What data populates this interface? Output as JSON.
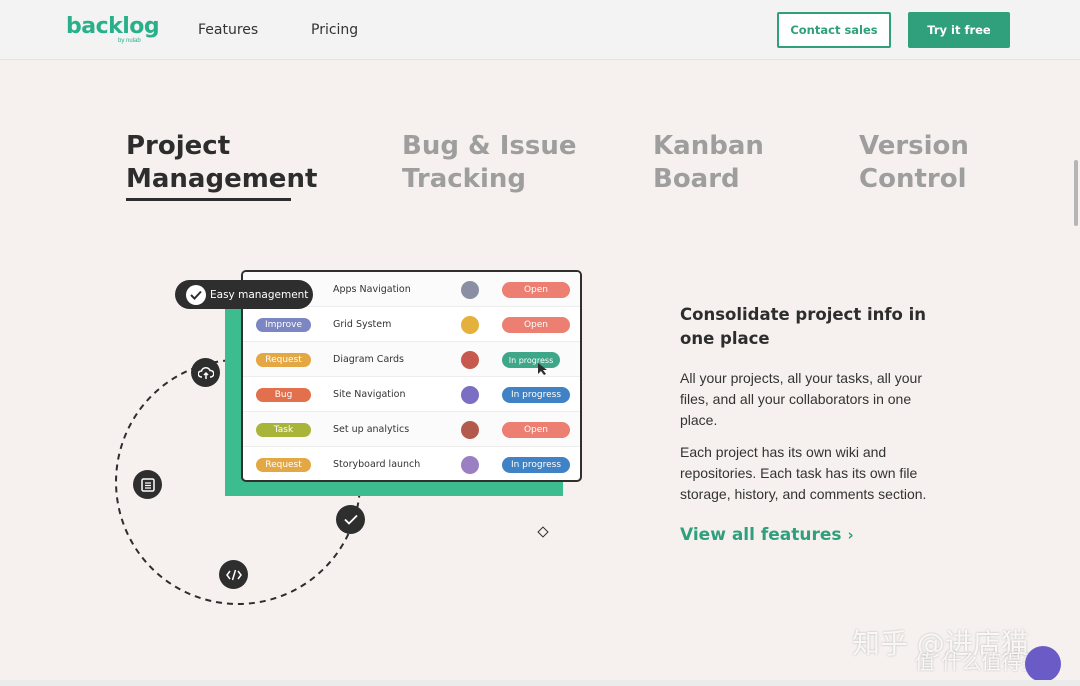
{
  "header": {
    "logo_text": "backlog",
    "logo_sub": "by nulab",
    "nav": [
      "Features",
      "Pricing"
    ],
    "contact_label": "Contact sales",
    "try_label": "Try it free"
  },
  "tabs": [
    {
      "line1": "Project",
      "line2": "Management",
      "active": true
    },
    {
      "line1": "Bug & Issue",
      "line2": "Tracking",
      "active": false
    },
    {
      "line1": "Kanban",
      "line2": "Board",
      "active": false
    },
    {
      "line1": "Version",
      "line2": "Control",
      "active": false
    }
  ],
  "illustration": {
    "pill_label": "Easy management",
    "rows": [
      {
        "chip": "",
        "chip_color": "",
        "title": "Apps Navigation",
        "avatar_color": "#8a8fa3",
        "status": "Open",
        "status_kind": "open"
      },
      {
        "chip": "Improve",
        "chip_color": "#7b86c2",
        "title": "Grid System",
        "avatar_color": "#e3b13c",
        "status": "Open",
        "status_kind": "open"
      },
      {
        "chip": "Request",
        "chip_color": "#e3a843",
        "title": "Diagram Cards",
        "avatar_color": "#c65a4f",
        "status": "In progress",
        "status_kind": "prog2"
      },
      {
        "chip": "Bug",
        "chip_color": "#e2704d",
        "title": "Site Navigation",
        "avatar_color": "#7a6fc2",
        "status": "In progress",
        "status_kind": "prog"
      },
      {
        "chip": "Task",
        "chip_color": "#a8b53a",
        "title": "Set up analytics",
        "avatar_color": "#b45a4c",
        "status": "Open",
        "status_kind": "open"
      },
      {
        "chip": "Request",
        "chip_color": "#e3a843",
        "title": "Storyboard launch",
        "avatar_color": "#9a7fc2",
        "status": "In progress",
        "status_kind": "prog"
      }
    ]
  },
  "content": {
    "heading": "Consolidate project info in one place",
    "para1": "All your projects, all your tasks, all your files, and all your collaborators in one place.",
    "para2": "Each project has its own wiki and repositories. Each task has its own file storage, history, and comments section.",
    "view_all": "View all features"
  },
  "watermark": {
    "line1": "知乎 @进店猫",
    "line2": "值 什么值得买"
  },
  "colors": {
    "brand_green": "#2f9f7c",
    "background": "#f6f1ee",
    "dark": "#2d2d2d"
  }
}
